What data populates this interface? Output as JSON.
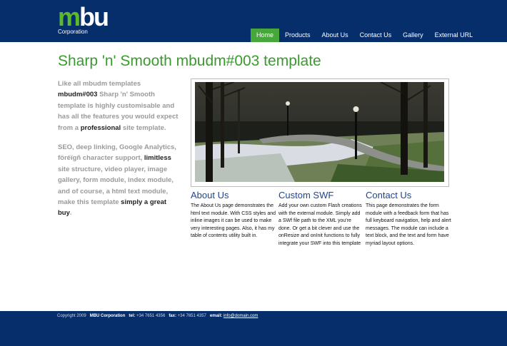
{
  "header": {
    "logo_main_m": "m",
    "logo_main_bu": "bu",
    "logo_sub": "Corporation",
    "nav": [
      "Home",
      "Products",
      "About Us",
      "Contact Us",
      "Gallery",
      "External URL"
    ],
    "active_nav": "Home"
  },
  "colors": {
    "header_bg": "#062e6b",
    "accent_green": "#47a73a",
    "title_green": "#3a9a2e",
    "heading_blue": "#1d4690"
  },
  "page_title": "Sharp 'n' Smooth mbudm#003 template",
  "intro": {
    "p1": [
      "Like all mbudm templates ",
      "mbudm#003",
      " Sharp 'n' Smooth template is highly customisable and has all the features you would expect from a ",
      "professional",
      " site template."
    ],
    "p2": [
      "SEO, deep linking, Google Analytics, föréïgñ character support, ",
      "limitless",
      " site structure, video player, image gallery, form module, index module, and of course, a html text module, make this template ",
      "simply a great buy",
      "."
    ]
  },
  "columns": [
    {
      "heading": "About Us",
      "text": "The About Us page demonstrates the html text module. With CSS styles and inline images it can be used to make very interesting pages. Also, it has my table of contents utility built in."
    },
    {
      "heading": "Custom SWF",
      "text": "Add your own custom Flash creations with the external module. Simply add a SWf file path to the XML you're done. Or get a bit clever and use the onResize and onInit functions to fully integrate your SWF into this template"
    },
    {
      "heading": "Contact Us",
      "text": "This page demonstrates the form module with a feedback form that has full keyboard navigation, help and alert messages. The module can include a text block, and the text and form have myriad layout options."
    }
  ],
  "footer": {
    "copyright": "Copyright 2009",
    "company": "MBU Corporation",
    "tel_label": "tel:",
    "tel": "+34 7651 4356",
    "fax_label": "fax:",
    "fax": "+34 7651 4357",
    "email_label": "email:",
    "email": "info@domain.com"
  }
}
